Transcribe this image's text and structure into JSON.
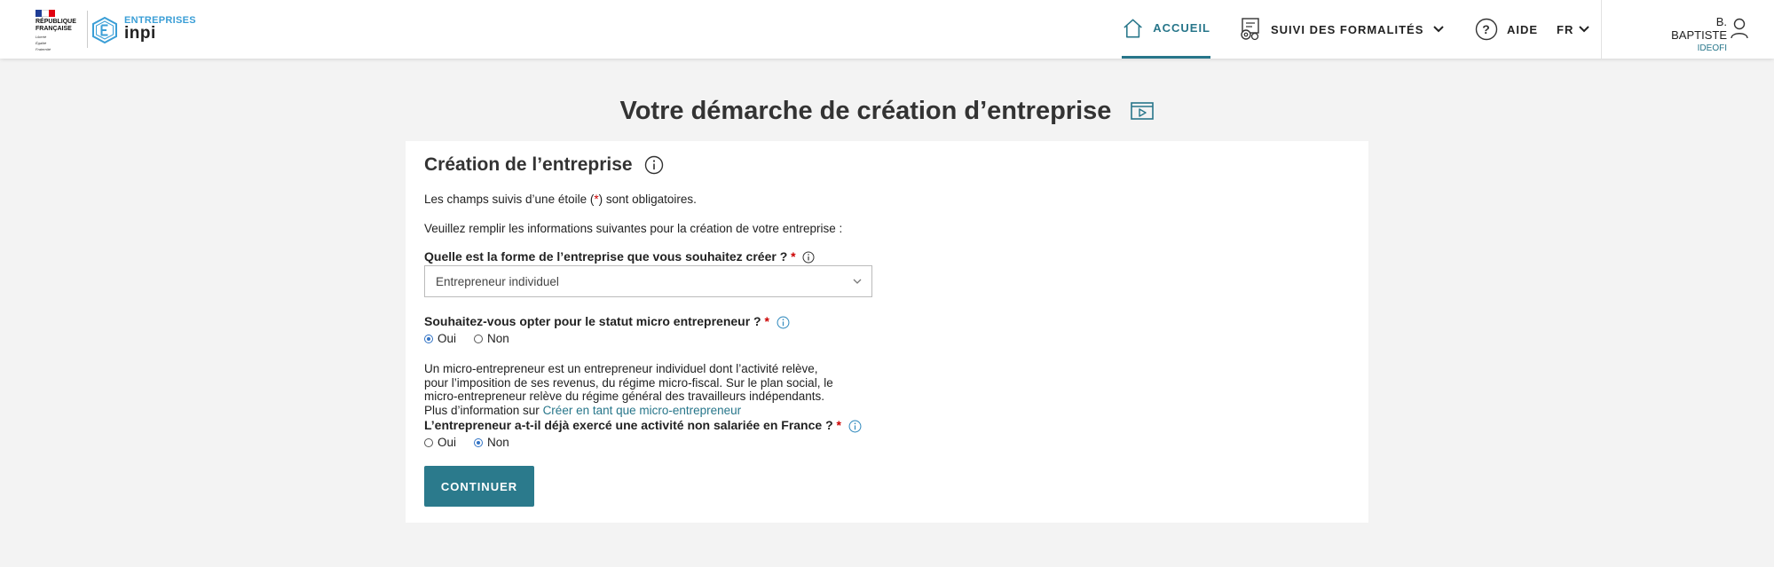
{
  "header": {
    "rf_logo_lines": [
      "RÉPUBLIQUE",
      "FRANÇAISE"
    ],
    "rf_motto": [
      "Liberté",
      "Égalité",
      "Fraternité"
    ],
    "brand_top": "ENTREPRISES",
    "brand_bottom": "inpi",
    "nav": {
      "accueil": "ACCUEIL",
      "suivi": "SUIVI DES FORMALITÉS",
      "aide": "AIDE",
      "lang": "FR"
    },
    "user": {
      "name": "B. BAPTISTE",
      "org": "IDEOFI"
    },
    "accent_color": "#27768a"
  },
  "page": {
    "title": "Votre démarche de création d’entreprise"
  },
  "card": {
    "title": "Création de l’entreprise",
    "required_note_before": "Les champs suivis d’une étoile (",
    "required_star": "*",
    "required_note_after": ") sont obligatoires.",
    "intro": "Veuillez remplir les informations suivantes pour la création de votre entreprise :",
    "q1": {
      "label": "Quelle est la forme de l’entreprise que vous souhaitez créer ?",
      "star": "*",
      "selected": "Entrepreneur individuel"
    },
    "q2": {
      "label": "Souhaitez-vous opter pour le statut micro entrepreneur ?",
      "star": "*",
      "opt_yes": "Oui",
      "opt_no": "Non",
      "selected": "Oui"
    },
    "description": {
      "line1": "Un micro-entrepreneur est un entrepreneur individuel dont l’activité relève,",
      "line2": "pour l’imposition de ses revenus, du régime micro-fiscal. Sur le plan social, le",
      "line3": "micro-entrepreneur relève du régime général des travailleurs indépendants.",
      "more_prefix": "Plus d’information sur ",
      "more_link": "Créer en tant que micro-entrepreneur"
    },
    "q3": {
      "label": "L’entrepreneur a-t-il déjà exercé une activité non salariée en France ?",
      "star": "*",
      "opt_yes": "Oui",
      "opt_no": "Non",
      "selected": "Non"
    },
    "continue_label": "CONTINUER"
  }
}
